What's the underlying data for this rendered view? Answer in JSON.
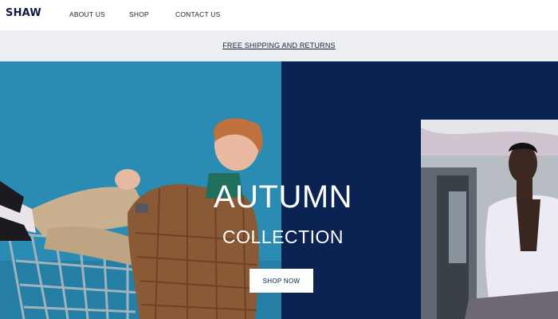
{
  "header": {
    "logo": "SHAW",
    "nav": [
      {
        "label": "ABOUT US"
      },
      {
        "label": "SHOP"
      },
      {
        "label": "CONTACT US"
      }
    ]
  },
  "announcement": {
    "text": "FREE SHIPPING AND RETURNS"
  },
  "hero": {
    "title": "AUTUMN",
    "subtitle": "COLLECTION",
    "cta_label": "SHOP NOW"
  },
  "colors": {
    "left_panel": "#2a8bb3",
    "right_panel": "#0a2353",
    "announcement_bg": "#eceef2",
    "text_dark": "#111a3a"
  }
}
